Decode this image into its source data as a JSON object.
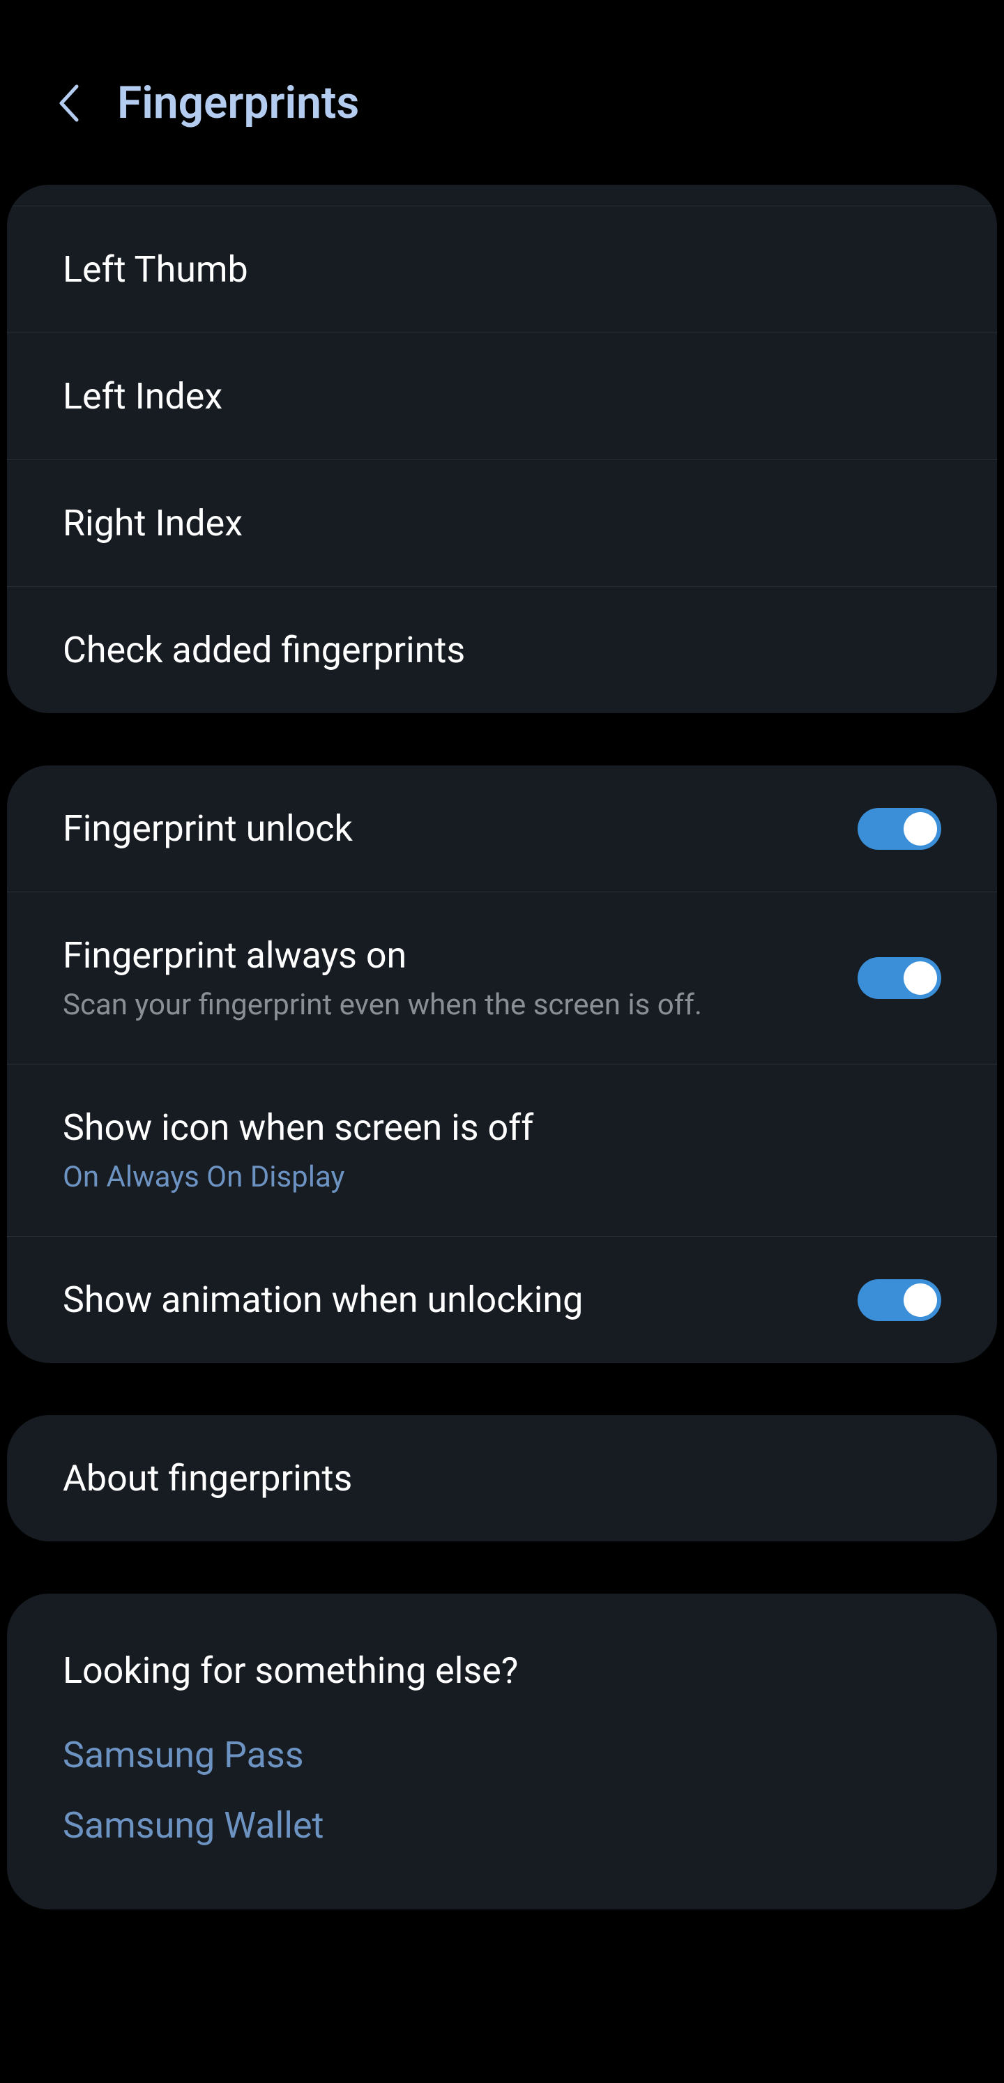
{
  "header": {
    "title": "Fingerprints"
  },
  "fingerprints": {
    "items": [
      {
        "label": "Left Thumb"
      },
      {
        "label": "Left Index"
      },
      {
        "label": "Right Index"
      },
      {
        "label": "Check added fingerprints"
      }
    ]
  },
  "settings": {
    "unlock": {
      "label": "Fingerprint unlock",
      "on": true
    },
    "alwaysOn": {
      "label": "Fingerprint always on",
      "subtitle": "Scan your fingerprint even when the screen is off.",
      "on": true
    },
    "showIcon": {
      "label": "Show icon when screen is off",
      "subtitle": "On Always On Display"
    },
    "animation": {
      "label": "Show animation when unlocking",
      "on": true
    }
  },
  "about": {
    "label": "About fingerprints"
  },
  "footer": {
    "heading": "Looking for something else?",
    "links": [
      {
        "label": "Samsung Pass"
      },
      {
        "label": "Samsung Wallet"
      }
    ]
  }
}
